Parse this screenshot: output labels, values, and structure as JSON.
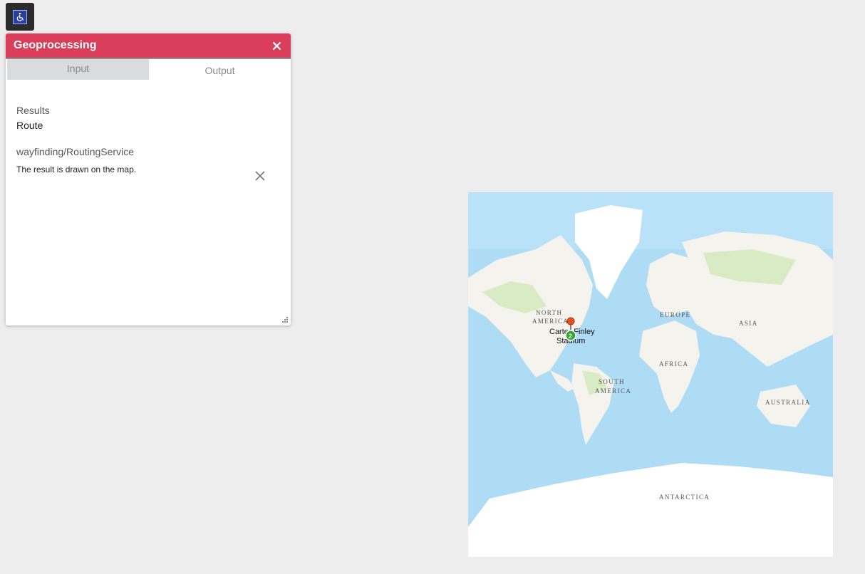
{
  "accessibility": {
    "icon": "wheelchair-icon"
  },
  "panel": {
    "title": "Geoprocessing",
    "close_icon": "close-icon",
    "tabs": [
      {
        "label": "Input"
      },
      {
        "label": "Output"
      }
    ],
    "results_heading": "Results",
    "result_name": "Route",
    "service_name": "wayfinding/RoutingService",
    "result_message": "The result is drawn on the map.",
    "clear_icon": "close-icon"
  },
  "map": {
    "labels": {
      "north_america_1": "NORTH",
      "north_america_2": "AMERICA",
      "south_america_1": "SOUTH",
      "south_america_2": "AMERICA",
      "europe": "EUROPE",
      "asia": "ASIA",
      "africa": "AFRICA",
      "australia": "AUSTRALIA",
      "antarctica": "ANTARCTICA"
    },
    "place": {
      "line1": "Carter-Finley",
      "line2": "Stadium"
    },
    "cluster_count": "2",
    "colors": {
      "ocean": "#aedcf5",
      "land": "#f4f3ee",
      "vegetation": "#d9ebc4",
      "ice": "#ffffff",
      "pin": "#e8501e",
      "cluster": "#2ea82e"
    }
  }
}
